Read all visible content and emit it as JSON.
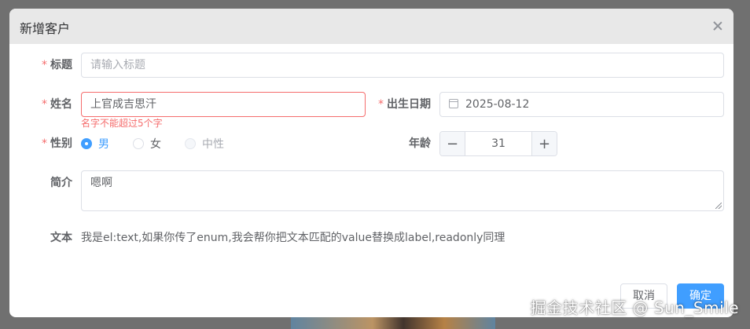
{
  "dialog": {
    "title": "新增客户"
  },
  "form": {
    "title_field": {
      "label": "标题",
      "required_mark": "*",
      "placeholder": "请输入标题"
    },
    "name_field": {
      "label": "姓名",
      "required_mark": "*",
      "value": "上官成吉思汗",
      "error": "名字不能超过5个字"
    },
    "birth_field": {
      "label": "出生日期",
      "required_mark": "*",
      "value": "2025-08-12"
    },
    "gender_field": {
      "label": "性别",
      "required_mark": "*",
      "options": [
        {
          "label": "男",
          "checked": true,
          "disabled": false
        },
        {
          "label": "女",
          "checked": false,
          "disabled": false
        },
        {
          "label": "中性",
          "checked": false,
          "disabled": true
        }
      ]
    },
    "age_field": {
      "label": "年龄",
      "value": "31",
      "minus": "−",
      "plus": "+"
    },
    "intro_field": {
      "label": "简介",
      "value": "嗯啊"
    },
    "text_field": {
      "label": "文本",
      "value": "我是el:text,如果你传了enum,我会帮你把文本匹配的value替换成label,readonly同理"
    }
  },
  "footer": {
    "cancel_label": "取消",
    "confirm_label": "确定"
  },
  "watermark": "掘金技术社区 @ Sun_Smile",
  "colors": {
    "primary": "#409eff",
    "danger": "#f56c6c"
  }
}
